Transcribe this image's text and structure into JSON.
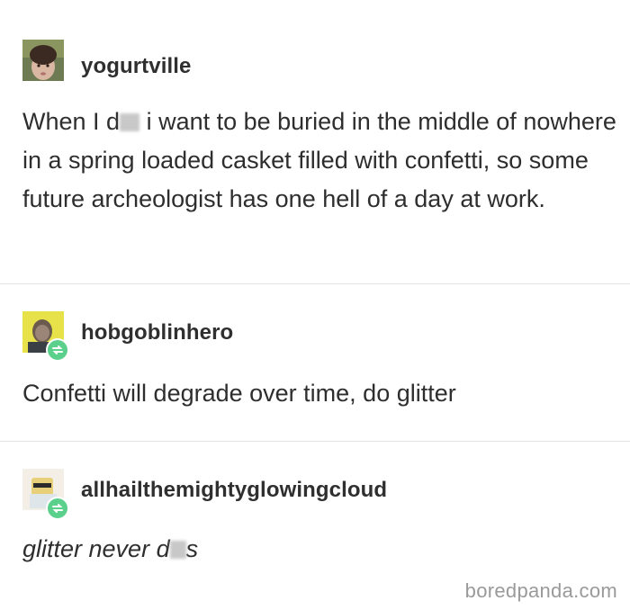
{
  "posts": [
    {
      "username": "yogurtville",
      "text_before": "When I d",
      "text_after": " i want to be buried in the middle of nowhere in a spring loaded casket filled with confetti, so some future archeologist has one hell of a day at work.",
      "avatar_icon": "user-photo-avatar",
      "reblog": false
    },
    {
      "username": "hobgoblinhero",
      "text": "Confetti will degrade over time, do glitter",
      "avatar_icon": "user-photo-avatar",
      "reblog": true,
      "badge_icon": "reblog-icon"
    },
    {
      "username": "allhailthemightyglowingcloud",
      "text_before": "glitter never d",
      "text_after": "s",
      "avatar_icon": "user-photo-avatar",
      "reblog": true,
      "badge_icon": "reblog-icon"
    }
  ],
  "watermark": "boredpanda.com",
  "colors": {
    "text": "#2e2e2e",
    "divider": "#e3e3e3",
    "reblog_badge": "#5bd08c",
    "watermark": "#9a9a9a"
  }
}
